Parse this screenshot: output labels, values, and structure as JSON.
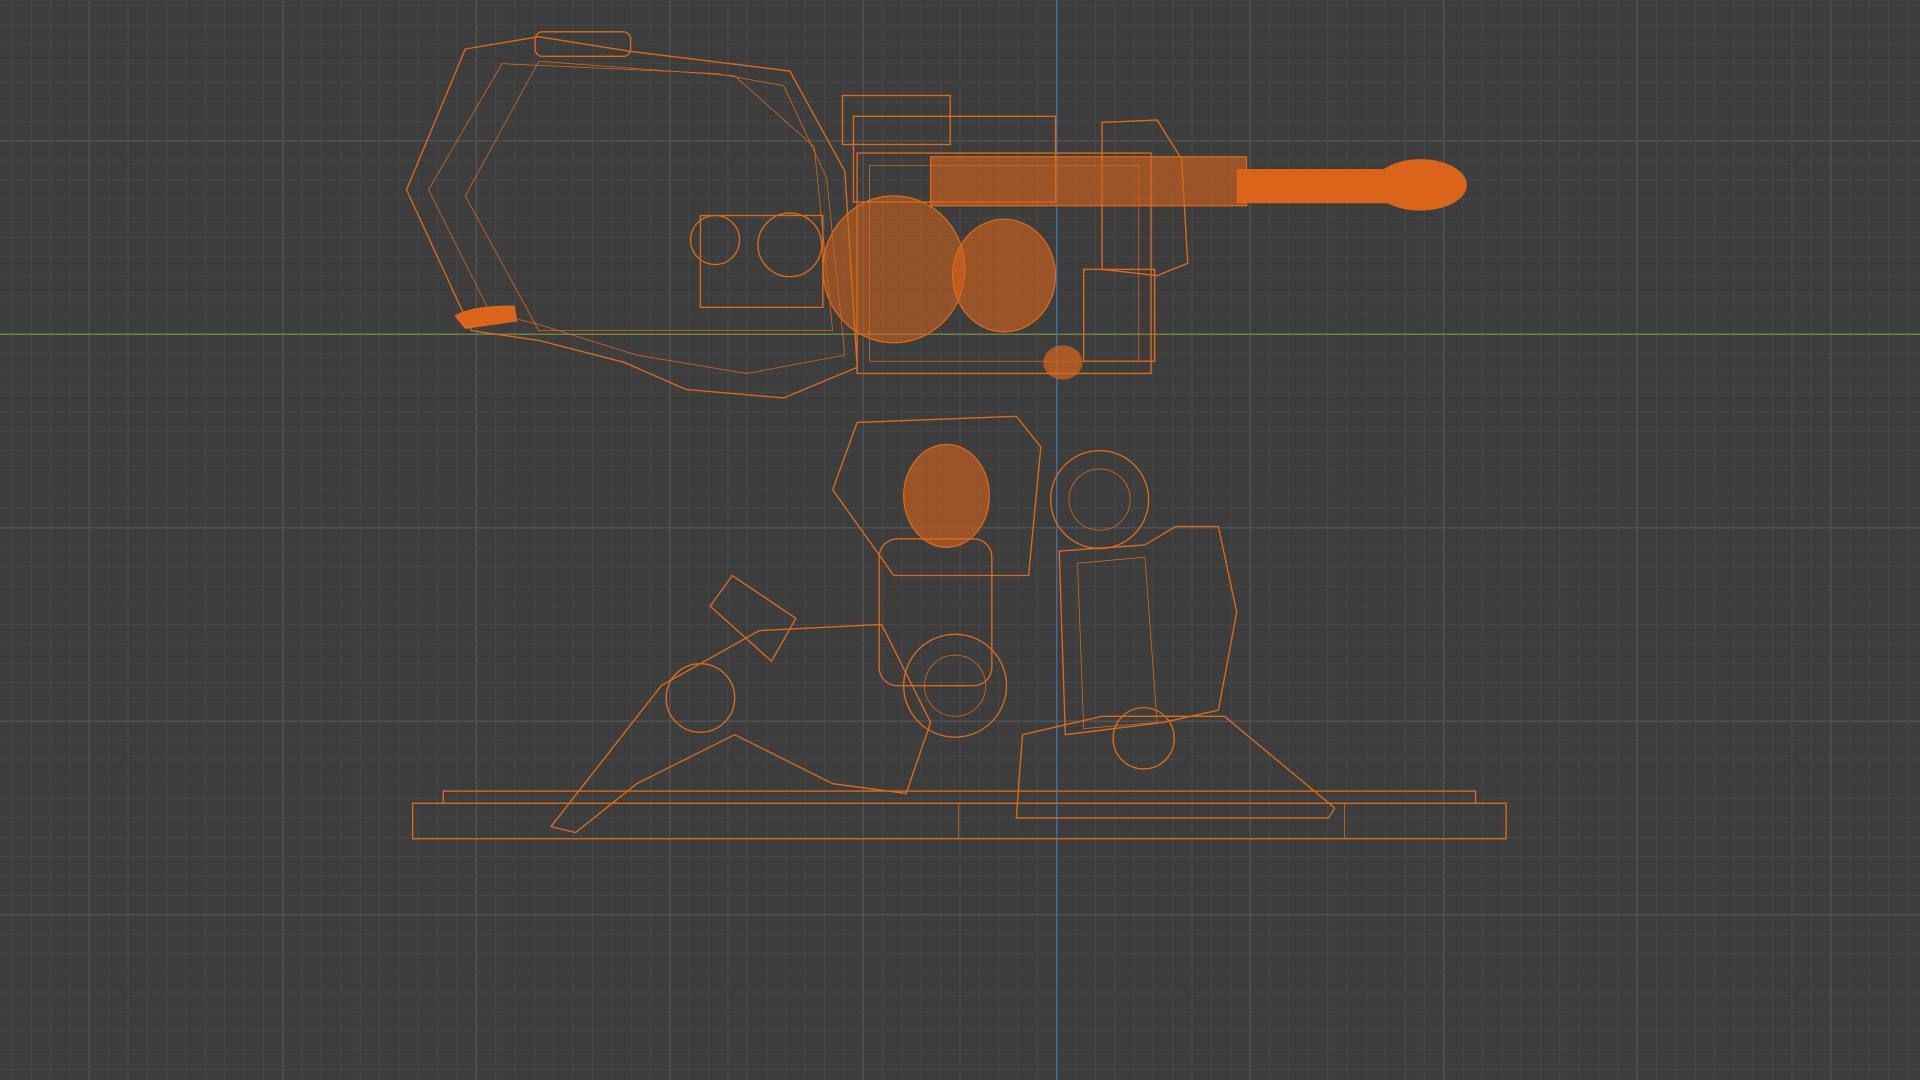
{
  "viewport": {
    "background_color": "#3d3d3d",
    "grid_minor_color": "#474747",
    "grid_major_color": "#525252",
    "x_axis_color": "#6f8f3a",
    "y_axis_color": "#3f6fa8",
    "wire_color": "#e06a1a",
    "solid_color": "#d9641a"
  }
}
